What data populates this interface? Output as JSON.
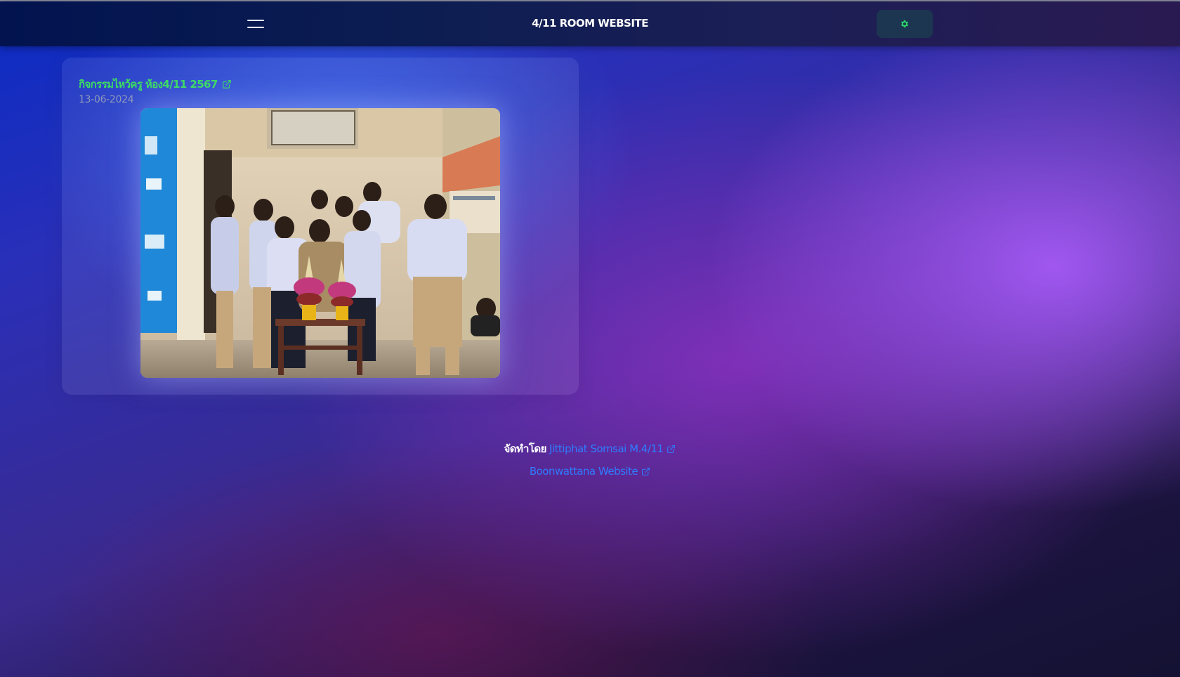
{
  "header": {
    "title": "4/11 ROOM WEBSITE",
    "menu_icon": "hamburger-menu-icon",
    "settings_icon": "gear-icon"
  },
  "post": {
    "title": "กิจกรรมไหว้ครู ห้อง4/11 2567",
    "date": "13-06-2024",
    "link_icon": "external-link-icon",
    "image_alt": "Class group photo at the teacher appreciation ceremony"
  },
  "footer": {
    "credit_prefix": "จัดทำโดย",
    "credit_name": "Jittiphat Somsai M.4/11",
    "site_link": "Boonwattana Website"
  },
  "colors": {
    "accent_green": "#3ddc63",
    "link_blue": "#2f7cff",
    "header_bg": "#0c1d52"
  }
}
